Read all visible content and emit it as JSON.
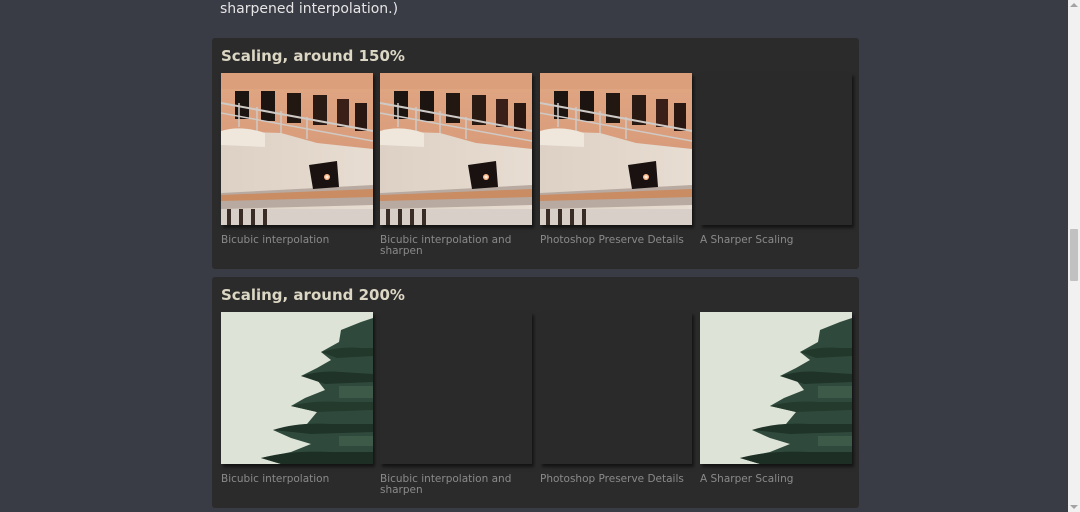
{
  "intro": {
    "partial_line": "sharpened interpolation.)"
  },
  "sections": [
    {
      "title": "Scaling, around 150%",
      "thumbnails": [
        {
          "caption": "Bicubic interpolation",
          "image": "ship-photo"
        },
        {
          "caption": "Bicubic interpolation and sharpen",
          "image": "ship-photo"
        },
        {
          "caption": "Photoshop Preserve Details",
          "image": "ship-photo"
        },
        {
          "caption": "A Sharper Scaling",
          "image": "empty"
        }
      ]
    },
    {
      "title": "Scaling, around 200%",
      "thumbnails": [
        {
          "caption": "Bicubic interpolation",
          "image": "pagoda-photo"
        },
        {
          "caption": "Bicubic interpolation and sharpen",
          "image": "empty"
        },
        {
          "caption": "Photoshop Preserve Details",
          "image": "empty"
        },
        {
          "caption": "A Sharper Scaling",
          "image": "pagoda-photo"
        }
      ]
    }
  ],
  "colors": {
    "page_background": "#393b45",
    "panel_background": "#2b2b2b",
    "title_text": "#dcd6c4",
    "caption_text": "#8a8a8a"
  }
}
